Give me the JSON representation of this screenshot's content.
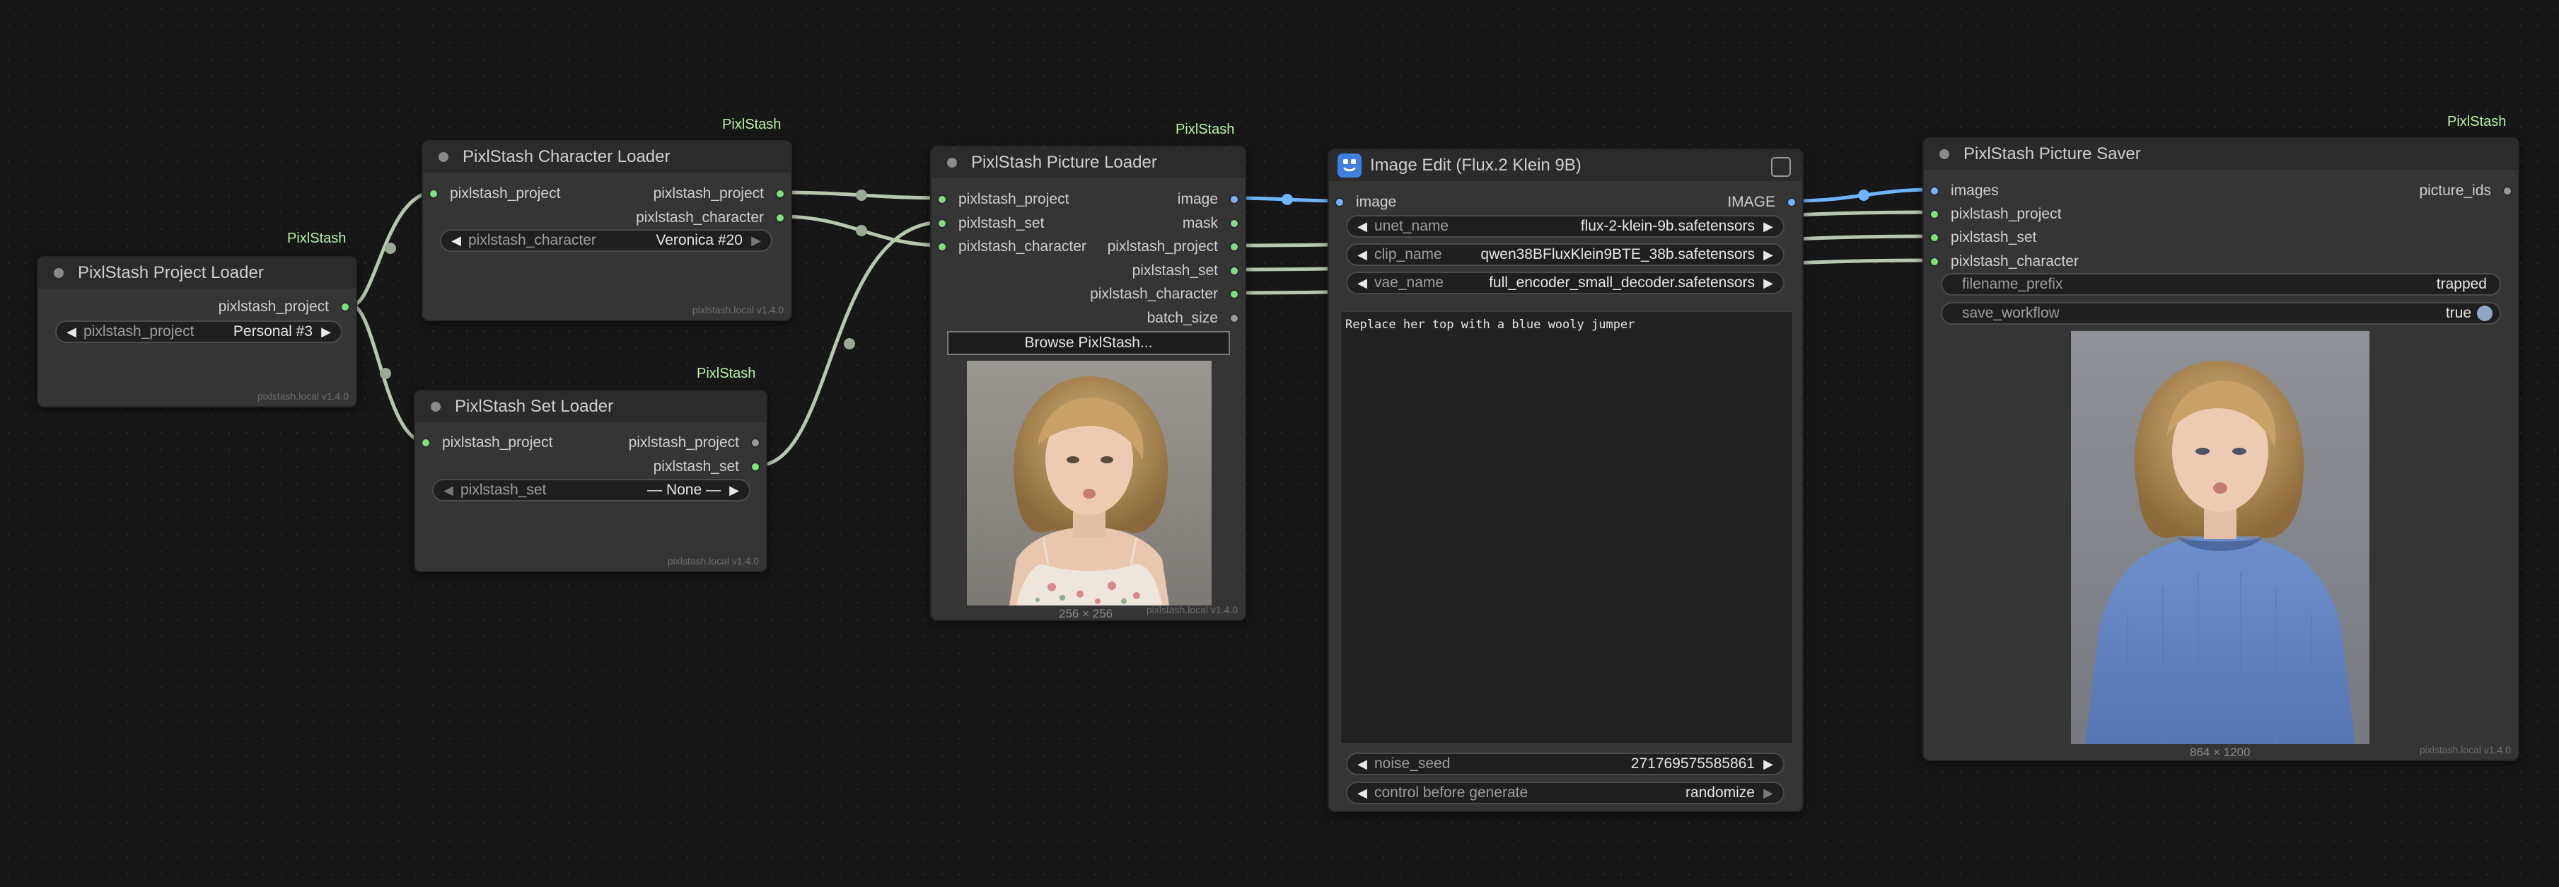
{
  "badge_text": "PixlStash",
  "footer_text": "pixlstash.local  v1.4.0",
  "colors": {
    "canvas": "#171717",
    "node": "#353535",
    "badge": "#b7f3a4",
    "link_green": "#b7c8b0",
    "link_blue": "#6fb4ff",
    "port_green": "#7ce07c"
  },
  "project_loader": {
    "title": "PixlStash Project Loader",
    "output": "pixlstash_project",
    "widget": {
      "name": "pixlstash_project",
      "value": "Personal #3"
    }
  },
  "character_loader": {
    "title": "PixlStash Character Loader",
    "input": "pixlstash_project",
    "outputs": [
      "pixlstash_project",
      "pixlstash_character"
    ],
    "widget": {
      "name": "pixlstash_character",
      "value": "Veronica #20"
    }
  },
  "set_loader": {
    "title": "PixlStash Set Loader",
    "input": "pixlstash_project",
    "outputs": [
      "pixlstash_project",
      "pixlstash_set"
    ],
    "widget": {
      "name": "pixlstash_set",
      "value": "— None —"
    }
  },
  "picture_loader": {
    "title": "PixlStash Picture Loader",
    "inputs": [
      "pixlstash_project",
      "pixlstash_set",
      "pixlstash_character"
    ],
    "outputs": [
      "image",
      "mask",
      "pixlstash_project",
      "pixlstash_set",
      "pixlstash_character",
      "batch_size"
    ],
    "browse_button": "Browse PixlStash...",
    "image_size": "256 × 256",
    "image_icon": "portrait-floral-top-thumbnail"
  },
  "image_edit": {
    "title": "Image Edit (Flux.2 Klein 9B)",
    "input": "image",
    "output": "IMAGE",
    "widgets": [
      {
        "name": "unet_name",
        "value": "flux-2-klein-9b.safetensors"
      },
      {
        "name": "clip_name",
        "value": "qwen38BFluxKlein9BTE_38b.safetensors"
      },
      {
        "name": "vae_name",
        "value": "full_encoder_small_decoder.safetensors"
      }
    ],
    "prompt": "Replace her top with a blue wooly jumper",
    "noise_seed": {
      "name": "noise_seed",
      "value": "271769575585861"
    },
    "control": {
      "name": "control before generate",
      "value": "randomize"
    }
  },
  "picture_saver": {
    "title": "PixlStash Picture Saver",
    "inputs": [
      "images",
      "pixlstash_project",
      "pixlstash_set",
      "pixlstash_character"
    ],
    "output": "picture_ids",
    "filename_prefix": {
      "name": "filename_prefix",
      "value": "trapped"
    },
    "save_workflow": {
      "name": "save_workflow",
      "value": "true"
    },
    "image_size": "864 × 1200",
    "image_icon": "portrait-blue-jumper-output"
  }
}
